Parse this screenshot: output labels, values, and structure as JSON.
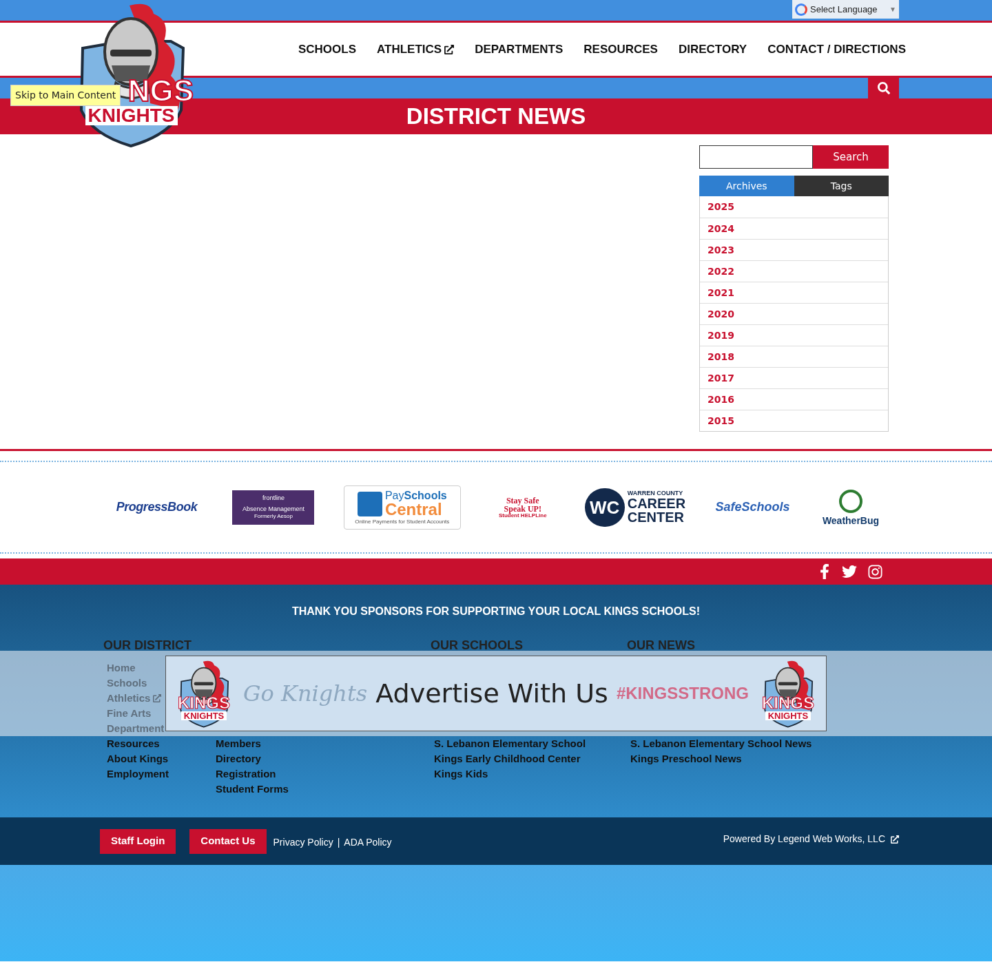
{
  "language": {
    "label": "Select Language",
    "caret": "▼"
  },
  "logo": {
    "line_1": "NGS",
    "line_2": "KNIGHTS"
  },
  "skip_link": "Skip to Main Content",
  "nav": [
    {
      "label": "SCHOOLS",
      "external": false
    },
    {
      "label": "ATHLETICS",
      "external": true
    },
    {
      "label": "DEPARTMENTS",
      "external": false
    },
    {
      "label": "RESOURCES",
      "external": false
    },
    {
      "label": "DIRECTORY",
      "external": false
    },
    {
      "label": "CONTACT / DIRECTIONS",
      "external": false
    }
  ],
  "page_title": "DISTRICT NEWS",
  "sidebar": {
    "search_button": "Search",
    "tabs": [
      {
        "label": "Archives",
        "selected": true
      },
      {
        "label": "Tags",
        "selected": false
      }
    ],
    "archives": [
      "2025",
      "2024",
      "2023",
      "2022",
      "2021",
      "2020",
      "2019",
      "2018",
      "2017",
      "2016",
      "2015"
    ]
  },
  "partners": [
    {
      "kind": "progressbook",
      "lines": [
        "ProgressBook"
      ]
    },
    {
      "kind": "frontline",
      "lines": [
        "frontline",
        "Absence Management",
        "Formerly Aesop"
      ]
    },
    {
      "kind": "payschools",
      "lines": [
        "Pay",
        "Schools",
        "Central",
        "Online Payments for Student Accounts"
      ]
    },
    {
      "kind": "staysafe",
      "lines": [
        "Stay Safe",
        "Speak UP!",
        "Student HELPLine"
      ]
    },
    {
      "kind": "warren",
      "lines": [
        "WC",
        "WARREN COUNTY",
        "CAREER",
        "CENTER"
      ]
    },
    {
      "kind": "safeschools",
      "lines": [
        "SafeSchools"
      ]
    },
    {
      "kind": "weatherbug",
      "lines": [
        "WeatherBug"
      ]
    }
  ],
  "sponsor_text": "THANK YOU SPONSORS FOR SUPPORTING YOUR LOCAL KINGS SCHOOLS!",
  "footer_columns": [
    {
      "heading": "OUR DISTRICT",
      "lists": [
        [
          {
            "label": "Home",
            "external": false
          },
          {
            "label": "Schools",
            "external": false
          },
          {
            "label": "Athletics",
            "external": true
          },
          {
            "label": "Fine Arts",
            "external": false
          },
          {
            "label": "Department",
            "external": false
          },
          {
            "label": "Resources",
            "external": false
          },
          {
            "label": "About Kings",
            "external": false
          },
          {
            "label": "Employment",
            "external": false
          }
        ],
        [
          {
            "label": "Members",
            "external": false
          },
          {
            "label": "Directory",
            "external": false
          },
          {
            "label": "Registration",
            "external": false
          },
          {
            "label": "Student Forms",
            "external": false
          }
        ]
      ]
    },
    {
      "heading": "OUR SCHOOLS",
      "lists": [
        [
          {
            "label": "S. Lebanon Elementary School",
            "external": false
          },
          {
            "label": "Kings Early Childhood Center",
            "external": false
          },
          {
            "label": "Kings Kids",
            "external": false
          }
        ]
      ]
    },
    {
      "heading": "OUR NEWS",
      "lists": [
        [
          {
            "label": "S. Lebanon Elementary School News",
            "external": false
          },
          {
            "label": "Kings Preschool News",
            "external": false
          }
        ]
      ]
    }
  ],
  "ad_banner": {
    "script_text": "Go Knights",
    "title": "Advertise With Us",
    "hashtag": "#KINGSSTRONG",
    "left_logo": {
      "line_1": "KINGS",
      "line_2": "KNIGHTS"
    },
    "right_logo": {
      "line_1": "KINGS",
      "line_2": "KNIGHTS"
    }
  },
  "bottom_bar": {
    "buttons": [
      "Staff Login",
      "Contact Us"
    ],
    "links": [
      "Privacy Policy",
      "ADA Policy"
    ],
    "separator": "|",
    "credit": "Powered By Legend Web Works, LLC"
  }
}
